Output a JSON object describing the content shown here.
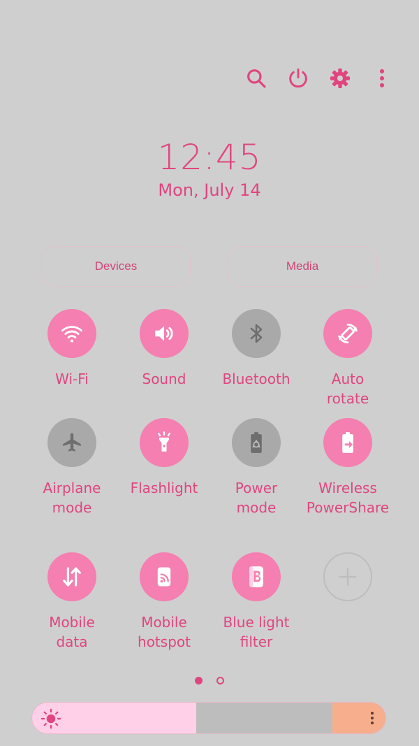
{
  "colors": {
    "accent": "#e0457f",
    "tile_on": "#f47fb0",
    "tile_off": "#a9a9a9",
    "background": "#cfcfcf"
  },
  "top_icons": [
    "search-icon",
    "power-icon",
    "settings-gear-icon",
    "more-vertical-icon"
  ],
  "clock": {
    "time": "12:45",
    "date": "Mon, July 14"
  },
  "pills": {
    "devices": "Devices",
    "media": "Media"
  },
  "tiles": [
    {
      "label": "Wi-Fi",
      "icon": "wifi-icon",
      "state": "on"
    },
    {
      "label": "Sound",
      "icon": "sound-icon",
      "state": "on"
    },
    {
      "label": "Bluetooth",
      "icon": "bluetooth-icon",
      "state": "off"
    },
    {
      "label": "Auto\nrotate",
      "icon": "auto-rotate-icon",
      "state": "on"
    },
    {
      "label": "Airplane\nmode",
      "icon": "airplane-icon",
      "state": "off"
    },
    {
      "label": "Flashlight",
      "icon": "flashlight-icon",
      "state": "on"
    },
    {
      "label": "Power\nmode",
      "icon": "power-mode-icon",
      "state": "off"
    },
    {
      "label": "Wireless\nPowerShare",
      "icon": "wireless-powershare-icon",
      "state": "on"
    },
    {
      "label": "Mobile\ndata",
      "icon": "mobile-data-icon",
      "state": "on"
    },
    {
      "label": "Mobile\nhotspot",
      "icon": "mobile-hotspot-icon",
      "state": "on"
    },
    {
      "label": "Blue light\nfilter",
      "icon": "blue-light-filter-icon",
      "state": "on"
    },
    {
      "label": "",
      "icon": "add-icon",
      "state": "add"
    }
  ],
  "pager": {
    "current_page": 1,
    "total_pages": 2
  },
  "brightness": {
    "level": 0.5,
    "icon": "sun-icon",
    "more_icon": "more-vertical-icon"
  }
}
